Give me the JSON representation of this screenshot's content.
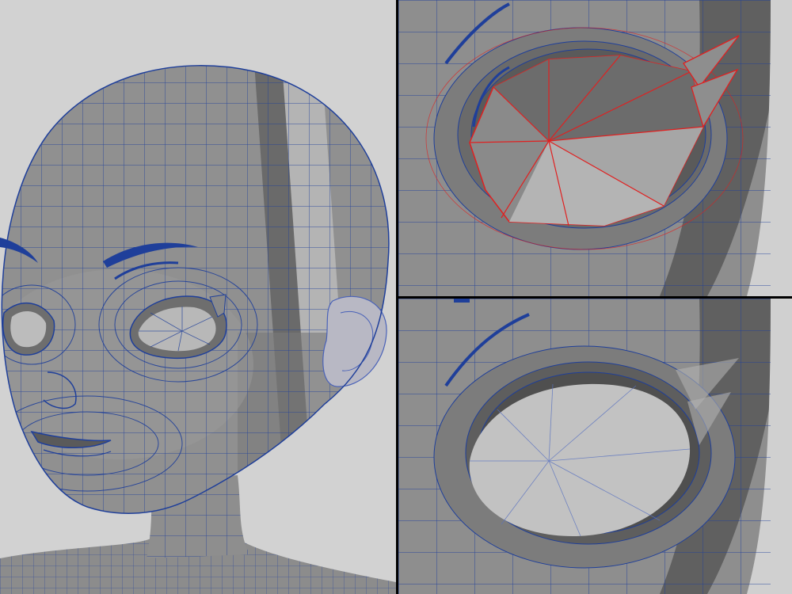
{
  "viewport": {
    "layout": "three-view",
    "panels": [
      {
        "id": "panel-head",
        "view": "head-wireframe"
      },
      {
        "id": "panel-eye-top",
        "view": "eye-socket-selected"
      },
      {
        "id": "panel-eye-bottom",
        "view": "eye-socket-filled"
      }
    ]
  },
  "colors": {
    "background": "#d2d2d2",
    "mesh_surface": "#8a8a8a",
    "mesh_light": "#a8a8a8",
    "mesh_dark": "#5e5e5e",
    "wireframe": "#1f3f9a",
    "selection": "#e02020",
    "divider": "#000000"
  }
}
